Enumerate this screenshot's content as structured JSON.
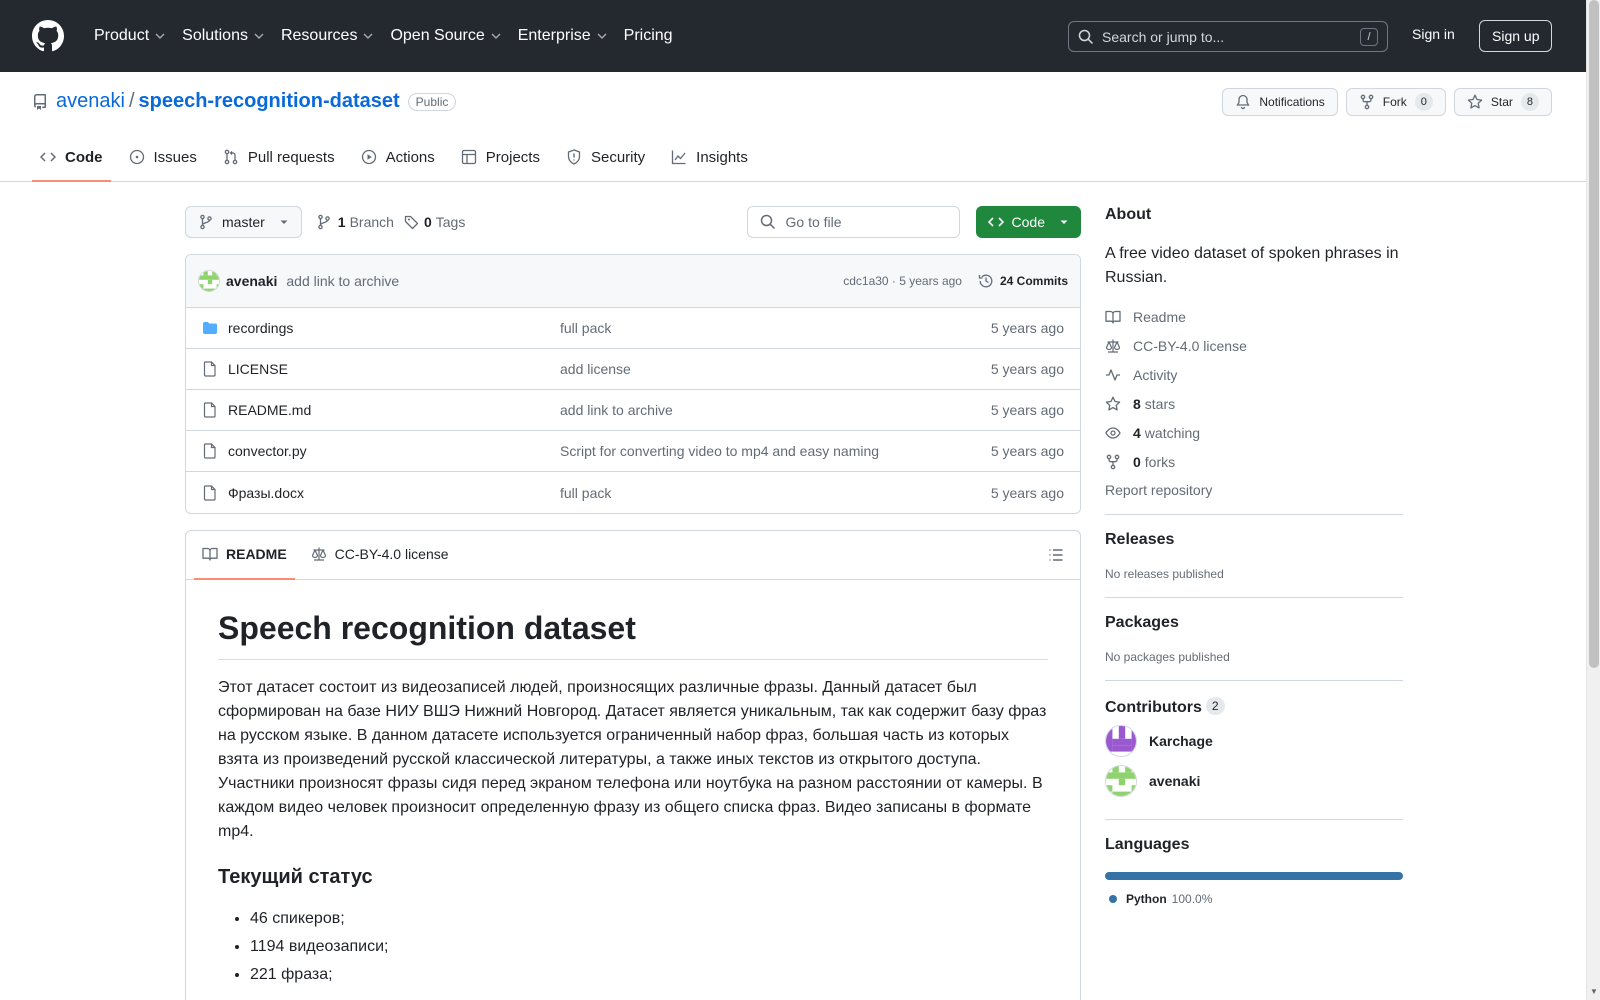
{
  "header": {
    "nav": [
      "Product",
      "Solutions",
      "Resources",
      "Open Source",
      "Enterprise",
      "Pricing"
    ],
    "search_placeholder": "Search or jump to...",
    "search_shortcut": "/",
    "signin": "Sign in",
    "signup": "Sign up"
  },
  "repo": {
    "owner": "avenaki",
    "separator": "/",
    "name": "speech-recognition-dataset",
    "visibility": "Public",
    "notifications": "Notifications",
    "fork_label": "Fork",
    "fork_count": "0",
    "star_label": "Star",
    "star_count": "8"
  },
  "tabs": [
    "Code",
    "Issues",
    "Pull requests",
    "Actions",
    "Projects",
    "Security",
    "Insights"
  ],
  "toolbar": {
    "branch": "master",
    "branch_count": "1",
    "branch_label": "Branch",
    "tag_count": "0",
    "tag_label": "Tags",
    "go_to_file": "Go to file",
    "code_button": "Code"
  },
  "latest_commit": {
    "author": "avenaki",
    "message": "add link to archive",
    "hash_time": "cdc1a30 · 5 years ago",
    "commits": "24 Commits"
  },
  "files": [
    {
      "type": "folder",
      "name": "recordings",
      "message": "full pack",
      "date": "5 years ago"
    },
    {
      "type": "file",
      "name": "LICENSE",
      "message": "add license",
      "date": "5 years ago"
    },
    {
      "type": "file",
      "name": "README.md",
      "message": "add link to archive",
      "date": "5 years ago"
    },
    {
      "type": "file",
      "name": "convector.py",
      "message": "Script for converting video to mp4 and easy naming",
      "date": "5 years ago"
    },
    {
      "type": "file",
      "name": "Фразы.docx",
      "message": "full pack",
      "date": "5 years ago"
    }
  ],
  "readme": {
    "tab_readme": "README",
    "tab_license": "CC-BY-4.0 license",
    "title": "Speech recognition dataset",
    "paragraph": "Этот датасет состоит из видеозаписей людей, произносящих различные фразы. Данный датасет был сформирован на базе НИУ ВШЭ Нижний Новгород. Датасет является уникальным, так как содержит базу фраз на русском языке. В данном датасете используется ограниченный набор фраз, большая часть из которых взята из произведений русской классической литературы, а также иных текстов из открытого доступа. Участники произносят фразы сидя перед экраном телефона или ноутбука на разном расстоянии от камеры. В каждом видео человек произносит определенную фразу из общего списка фраз. Видео записаны в формате mp4.",
    "status_heading": "Текущий статус",
    "status_items": [
      "46 спикеров;",
      "1194 видеозаписи;",
      "221 фраза;"
    ]
  },
  "about": {
    "heading": "About",
    "description": "A free video dataset of spoken phrases in Russian.",
    "readme": "Readme",
    "license": "CC-BY-4.0 license",
    "activity": "Activity",
    "stars_count": "8",
    "stars_label": "stars",
    "watching_count": "4",
    "watching_label": "watching",
    "forks_count": "0",
    "forks_label": "forks",
    "report": "Report repository"
  },
  "releases": {
    "heading": "Releases",
    "text": "No releases published"
  },
  "packages": {
    "heading": "Packages",
    "text": "No packages published"
  },
  "contributors": {
    "heading": "Contributors",
    "count": "2",
    "list": [
      "Karchage",
      "avenaki"
    ]
  },
  "languages": {
    "heading": "Languages",
    "items": [
      {
        "name": "Python",
        "percent": "100.0%",
        "color": "#3572A5"
      }
    ]
  },
  "colors": {
    "header_bg": "#24292f",
    "link": "#0969da",
    "primary_button": "#1f883d",
    "tab_underline": "#fd8c73"
  }
}
